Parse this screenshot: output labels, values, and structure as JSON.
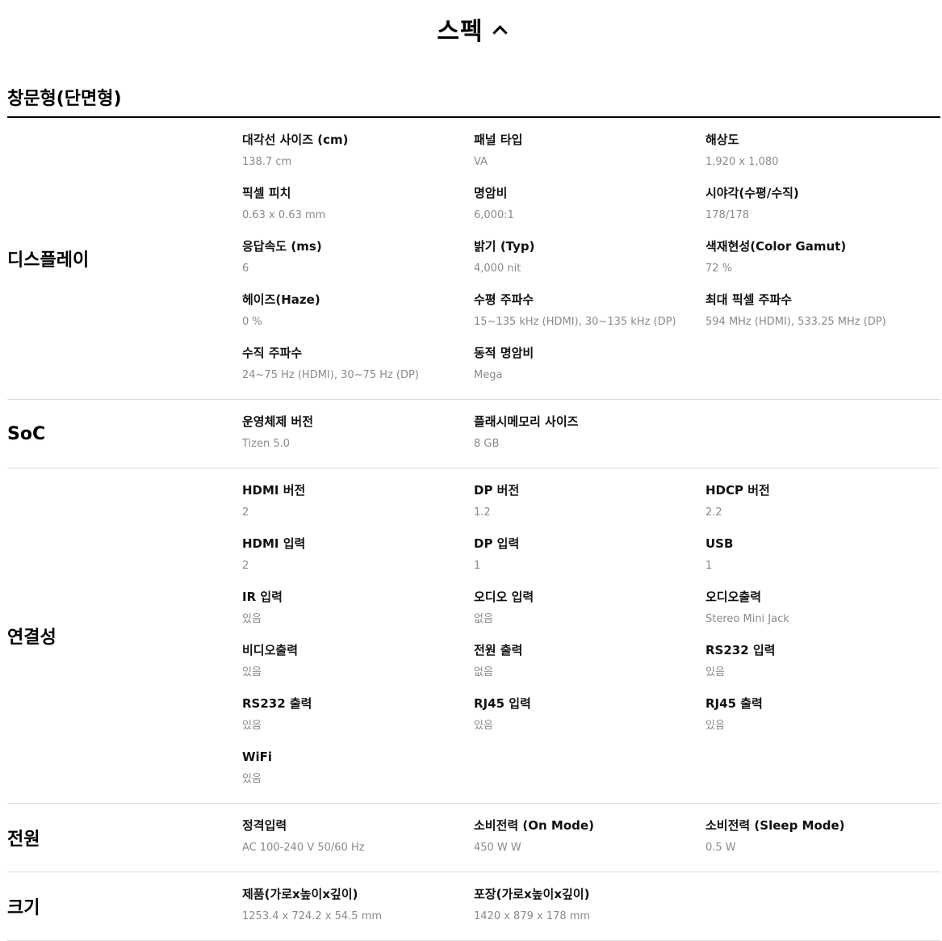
{
  "header": {
    "title": "스펙"
  },
  "model": "창문형(단면형)",
  "sections": [
    {
      "title": "디스플레이",
      "items": [
        {
          "label": "대각선 사이즈 (cm)",
          "value": "138.7 cm"
        },
        {
          "label": "패널 타입",
          "value": "VA"
        },
        {
          "label": "해상도",
          "value": "1,920 x 1,080"
        },
        {
          "label": "픽셀 피치",
          "value": "0.63 x 0.63 mm"
        },
        {
          "label": "명암비",
          "value": "6,000:1"
        },
        {
          "label": "시야각(수평/수직)",
          "value": "178/178"
        },
        {
          "label": "응답속도 (ms)",
          "value": "6"
        },
        {
          "label": "밝기 (Typ)",
          "value": "4,000 nit"
        },
        {
          "label": "색재현성(Color Gamut)",
          "value": "72 %"
        },
        {
          "label": "헤이즈(Haze)",
          "value": "0 %"
        },
        {
          "label": "수평 주파수",
          "value": "15~135 kHz (HDMI), 30~135 kHz (DP)"
        },
        {
          "label": "최대 픽셀 주파수",
          "value": "594 MHz (HDMI), 533.25 MHz (DP)"
        },
        {
          "label": "수직 주파수",
          "value": "24~75 Hz (HDMI), 30~75 Hz (DP)"
        },
        {
          "label": "동적 명암비",
          "value": "Mega"
        }
      ]
    },
    {
      "title": "SoC",
      "items": [
        {
          "label": "운영체제 버전",
          "value": "Tizen 5.0"
        },
        {
          "label": "플래시메모리 사이즈",
          "value": "8 GB"
        }
      ]
    },
    {
      "title": "연결성",
      "items": [
        {
          "label": "HDMI 버전",
          "value": "2"
        },
        {
          "label": "DP 버전",
          "value": "1.2"
        },
        {
          "label": "HDCP 버전",
          "value": "2.2"
        },
        {
          "label": "HDMI 입력",
          "value": "2"
        },
        {
          "label": "DP 입력",
          "value": "1"
        },
        {
          "label": "USB",
          "value": "1"
        },
        {
          "label": "IR 입력",
          "value": "있음"
        },
        {
          "label": "오디오 입력",
          "value": "없음"
        },
        {
          "label": "오디오출력",
          "value": "Stereo Mini Jack"
        },
        {
          "label": "비디오출력",
          "value": "있음"
        },
        {
          "label": "전원 출력",
          "value": "없음"
        },
        {
          "label": "RS232 입력",
          "value": "있음"
        },
        {
          "label": "RS232 출력",
          "value": "있음"
        },
        {
          "label": "RJ45 입력",
          "value": "있음"
        },
        {
          "label": "RJ45 출력",
          "value": "있음"
        },
        {
          "label": "WiFi",
          "value": "있음"
        }
      ]
    },
    {
      "title": "전원",
      "items": [
        {
          "label": "정격입력",
          "value": "AC 100-240 V 50/60 Hz"
        },
        {
          "label": "소비전력 (On Mode)",
          "value": "450 W W"
        },
        {
          "label": "소비전력 (Sleep Mode)",
          "value": "0.5 W"
        }
      ]
    },
    {
      "title": "크기",
      "items": [
        {
          "label": "제품(가로x높이x깊이)",
          "value": "1253.4 x 724.2 x 54.5 mm"
        },
        {
          "label": "포장(가로x높이x깊이)",
          "value": "1420 x 879 x 178 mm"
        }
      ]
    }
  ]
}
